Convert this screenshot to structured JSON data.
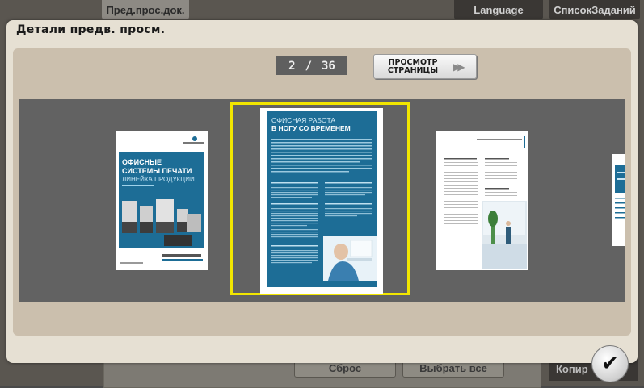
{
  "background": {
    "tab_preview": "Пред.прос.док.",
    "tab_language": "Language",
    "tab_jobs": "СписокЗаданий",
    "btn_reset": "Сброс",
    "btn_select_all": "Выбрать все",
    "btn_copy": "Копир"
  },
  "dialog": {
    "title": "Детали предв. просм.",
    "page_current": "2",
    "page_separator": "/",
    "page_total": "36",
    "preview_button_line1": "ПРОСМОТР",
    "preview_button_line2": "СТРАНИЦЫ",
    "ok_icon": "checkmark-icon"
  },
  "pages": [
    {
      "title_line1": "ОФИСНЫЕ",
      "title_line2": "СИСТЕМЫ ПЕЧАТИ",
      "subtitle": "ЛИНЕЙКА ПРОДУКЦИИ"
    },
    {
      "title_line1": "ОФИСНАЯ РАБОТА",
      "title_line2": "В НОГУ СО ВРЕМЕНЕМ"
    },
    {},
    {}
  ],
  "colors": {
    "accent_blue": "#1d6d96",
    "selection": "#f2e600"
  }
}
